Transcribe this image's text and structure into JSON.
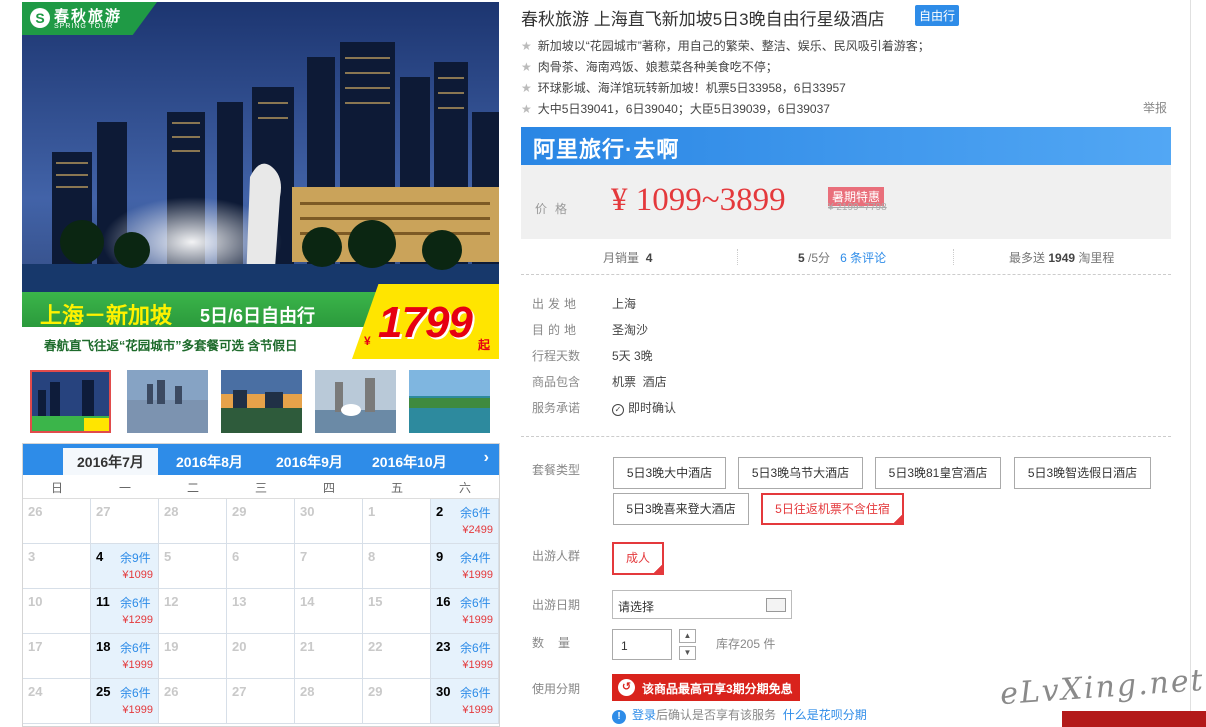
{
  "hero": {
    "brand_cn": "春秋旅游",
    "brand_en": "SPRING TOUR",
    "route": "上海－新加坡",
    "duration": "5日/6日自由行",
    "subtitle": "春航直飞往返“花园城市”多套餐可选 含节假日",
    "price_symbol": "¥",
    "price": "1799",
    "price_suffix": "起"
  },
  "calendar": {
    "months": [
      "2016年7月",
      "2016年8月",
      "2016年9月",
      "2016年10月"
    ],
    "active_month": 0,
    "weekdays": [
      "日",
      "一",
      "二",
      "三",
      "四",
      "五",
      "六"
    ],
    "days": [
      {
        "d": "26",
        "on": false
      },
      {
        "d": "27",
        "on": false
      },
      {
        "d": "28",
        "on": false
      },
      {
        "d": "29",
        "on": false
      },
      {
        "d": "30",
        "on": false
      },
      {
        "d": "1",
        "on": false
      },
      {
        "d": "2",
        "on": true,
        "rem": "余6件",
        "price": "¥2499"
      },
      {
        "d": "3",
        "on": false
      },
      {
        "d": "4",
        "on": true,
        "rem": "余9件",
        "price": "¥1099"
      },
      {
        "d": "5",
        "on": false
      },
      {
        "d": "6",
        "on": false
      },
      {
        "d": "7",
        "on": false
      },
      {
        "d": "8",
        "on": false
      },
      {
        "d": "9",
        "on": true,
        "rem": "余4件",
        "price": "¥1999"
      },
      {
        "d": "10",
        "on": false
      },
      {
        "d": "11",
        "on": true,
        "rem": "余6件",
        "price": "¥1299"
      },
      {
        "d": "12",
        "on": false
      },
      {
        "d": "13",
        "on": false
      },
      {
        "d": "14",
        "on": false
      },
      {
        "d": "15",
        "on": false
      },
      {
        "d": "16",
        "on": true,
        "rem": "余6件",
        "price": "¥1999"
      },
      {
        "d": "17",
        "on": false
      },
      {
        "d": "18",
        "on": true,
        "rem": "余6件",
        "price": "¥1999"
      },
      {
        "d": "19",
        "on": false
      },
      {
        "d": "20",
        "on": false
      },
      {
        "d": "21",
        "on": false
      },
      {
        "d": "22",
        "on": false
      },
      {
        "d": "23",
        "on": true,
        "rem": "余6件",
        "price": "¥1999"
      },
      {
        "d": "24",
        "on": false
      },
      {
        "d": "25",
        "on": true,
        "rem": "余6件",
        "price": "¥1999"
      },
      {
        "d": "26",
        "on": false
      },
      {
        "d": "27",
        "on": false
      },
      {
        "d": "28",
        "on": false
      },
      {
        "d": "29",
        "on": false
      },
      {
        "d": "30",
        "on": true,
        "rem": "余6件",
        "price": "¥1999"
      }
    ]
  },
  "product": {
    "title": "春秋旅游 上海直飞新加坡5日3晚自由行星级酒店",
    "badge": "自由行",
    "features": [
      "新加坡以“花园城市”著称，用自己的繁荣、整洁、娱乐、民风吸引着游客；",
      "肉骨茶、海南鸡饭、娘惹菜各种美食吃不停；",
      "环球影城、海洋馆玩转新加坡！机票5日33958，6日33957",
      "大中5日39041，6日39040；大臣5日39039，6日39037"
    ],
    "report": "举报",
    "alitrip": "阿里旅行·去啊",
    "price_label": "价格",
    "price": "¥ 1099~3899",
    "promo_tag": "暑期特惠",
    "old_price": "¥ 2199~7798",
    "sales_label": "月销量",
    "sales": "4",
    "rating": "5",
    "rating_unit": "/5分",
    "reviews": "6 条评论",
    "points_prefix": "最多送",
    "points": "1949",
    "points_suffix": "淘里程"
  },
  "details": {
    "rows": [
      {
        "label": "出发地",
        "value": "上海"
      },
      {
        "label": "目的地",
        "value": "圣淘沙"
      },
      {
        "label": "行程天数",
        "value": "5天 3晚"
      },
      {
        "label": "商品包含",
        "value": "机票  酒店"
      },
      {
        "label": "服务承诺",
        "value": "即时确认"
      }
    ]
  },
  "options": {
    "package_label": "套餐类型",
    "packages": [
      "5日3晚大中酒店",
      "5日3晚乌节大酒店",
      "5日3晚81皇宫酒店",
      "5日3晚智选假日酒店",
      "5日3晚喜来登大酒店",
      "5日往返机票不含住宿"
    ],
    "selected_package": 5,
    "crowd_label": "出游人群",
    "crowd": "成人",
    "date_label": "出游日期",
    "date_placeholder": "请选择",
    "qty_label": "数量",
    "qty": "1",
    "stock": "库存205 件",
    "installment_label": "使用分期",
    "installment": "该商品最高可享3期分期免息",
    "login_link": "登录",
    "login_text": "后确认是否享有该服务",
    "huabei_link": "什么是花呗分期"
  },
  "watermark": "eLvXing.net",
  "colors": {
    "accent": "#2e8ce8",
    "price": "#e4393c",
    "brand_green": "#1f9a45"
  }
}
